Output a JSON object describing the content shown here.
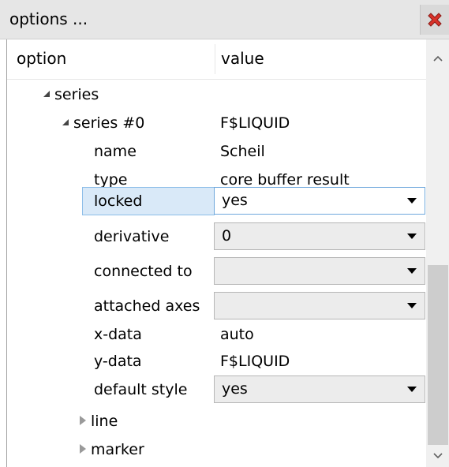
{
  "window": {
    "title": "options ...",
    "close_icon": "red-x-close-icon",
    "close_color": "#d9322a"
  },
  "table": {
    "columns": [
      "option",
      "value"
    ],
    "rows": {
      "series": {
        "label": "series"
      },
      "series0": {
        "label": "series #0",
        "value": "F$LIQUID"
      },
      "name": {
        "label": "name",
        "value": "Scheil"
      },
      "type": {
        "label": "type",
        "value": "core buffer result"
      },
      "locked": {
        "label": "locked",
        "value": "yes"
      },
      "derivative": {
        "label": "derivative",
        "value": "0"
      },
      "connected_to": {
        "label": "connected to",
        "value": ""
      },
      "attached_axes": {
        "label": "attached axes",
        "value": ""
      },
      "x_data": {
        "label": "x-data",
        "value": "auto"
      },
      "y_data": {
        "label": "y-data",
        "value": "F$LIQUID"
      },
      "default_style": {
        "label": "default style",
        "value": "yes"
      },
      "line": {
        "label": "line"
      },
      "marker": {
        "label": "marker"
      }
    }
  },
  "colors": {
    "selection_fill": "#d9e9f8",
    "selection_border": "#8cbde8"
  }
}
